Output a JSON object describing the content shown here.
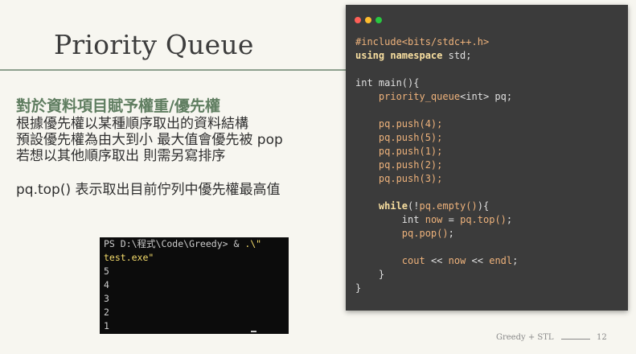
{
  "slide": {
    "title": "Priority Queue",
    "body": {
      "heading": "對於資料項目賦予權重/優先權",
      "lines": [
        "根據優先權以某種順序取出的資料結構",
        "預設優先權為由大到小 最大值會優先被 pop",
        "若想以其他順序取出 則需另寫排序"
      ],
      "note": "pq.top() 表示取出目前佇列中優先權最高值"
    },
    "terminal": {
      "prompt": "PS D:\\程式\\Code\\Greedy> & ",
      "command_a": ".\\\"",
      "command_b": "test.exe\"",
      "output": [
        "5",
        "4",
        "3",
        "2",
        "1"
      ]
    },
    "code_window": {
      "dot_colors": [
        "#ff5f57",
        "#febc2e",
        "#28c840"
      ],
      "tokens": {
        "include": "#include<bits/stdc++.h>",
        "using_kw": "using namespace",
        "using_rest": " std;",
        "main_sig": "int main(){",
        "pq_type": "priority_queue",
        "pq_decl_rest": "<int> pq;",
        "push_lines": [
          "pq.push(4);",
          "pq.push(5);",
          "pq.push(1);",
          "pq.push(2);",
          "pq.push(3);"
        ],
        "while_kw": "while",
        "while_open": "(!",
        "while_cond": "pq.empty()",
        "while_close": "){",
        "now_type": "int",
        "now_name": "now",
        "now_eq": "=",
        "now_value": "pq.top()",
        "now_end": ";",
        "pop_call": "pq.pop()",
        "pop_end": ";",
        "cout_kw": "cout",
        "shift1": "<<",
        "cout_var": "now",
        "shift2": "<<",
        "cout_end_kw": "endl",
        "cout_semicolon": ";",
        "close_inner": "}",
        "close_outer": "}"
      }
    },
    "footer": {
      "text": "Greedy + STL",
      "page": "12"
    }
  }
}
